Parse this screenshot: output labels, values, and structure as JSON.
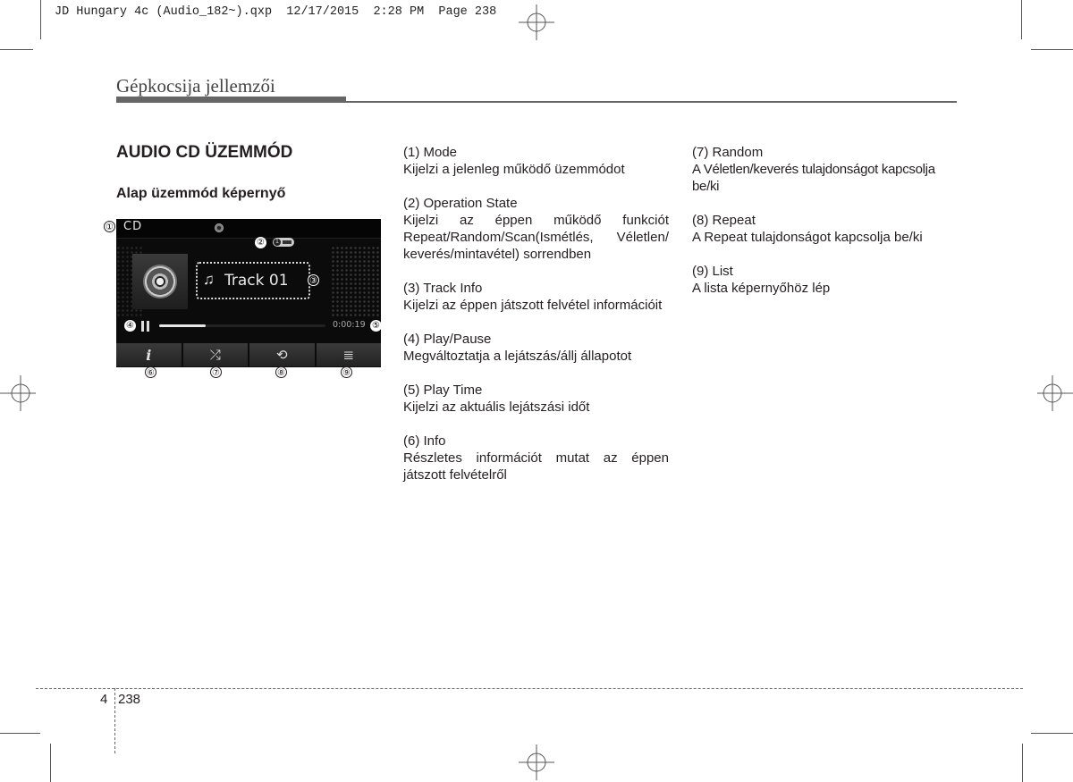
{
  "print_slug": "JD Hungary 4c (Audio_182~).qxp  12/17/2015  2:28 PM  Page 238",
  "section_header": "Gépkocsija jellemzői",
  "heading": "AUDIO CD ÜZEMMÓD",
  "subheading": "Alap üzemmód képernyő",
  "screen": {
    "mode_label": "CD",
    "track_title": "Track 01",
    "play_time": "0:00:19",
    "progress_fraction": 0.28,
    "operation_state_number": "1",
    "buttons": [
      {
        "name": "info",
        "glyph": "i",
        "icon": "info-icon"
      },
      {
        "name": "random",
        "glyph": "⤮",
        "icon": "shuffle-icon"
      },
      {
        "name": "repeat",
        "glyph": "⟲",
        "icon": "repeat-icon"
      },
      {
        "name": "list",
        "glyph": "≣",
        "icon": "list-icon"
      }
    ],
    "callouts": [
      "①",
      "②",
      "③",
      "④",
      "⑤",
      "⑥",
      "⑦",
      "⑧",
      "⑨"
    ]
  },
  "items_col1": [
    {
      "title": "(1) Mode",
      "desc": "Kijelzi a jelenleg működő üzemmódot"
    },
    {
      "title": "(2) Operation State",
      "desc": "Kijelzi az éppen működő funkciót Repeat/Random/Scan(Ismétlés, Véletlen/ keverés/mintavétel) sorrendben"
    },
    {
      "title": "(3) Track Info",
      "desc": "Kijelzi az éppen játszott felvétel információit"
    },
    {
      "title": "(4) Play/Pause",
      "desc": "Megváltoztatja a lejátszás/állj állapotot"
    },
    {
      "title": "(5) Play Time",
      "desc": "Kijelzi az aktuális lejátszási időt"
    },
    {
      "title": "(6) Info",
      "desc": "Részletes információt mutat az éppen játszott felvételről"
    }
  ],
  "items_col2": [
    {
      "title": "(7) Random",
      "desc": "A Véletlen/keverés tulajdonságot kapcsolja be/ki"
    },
    {
      "title": "(8) Repeat",
      "desc": "A Repeat tulajdonságot kapcsolja be/ki"
    },
    {
      "title": "(9) List",
      "desc": "A lista képernyőhöz lép"
    }
  ],
  "footer": {
    "chapter": "4",
    "page": "238"
  }
}
